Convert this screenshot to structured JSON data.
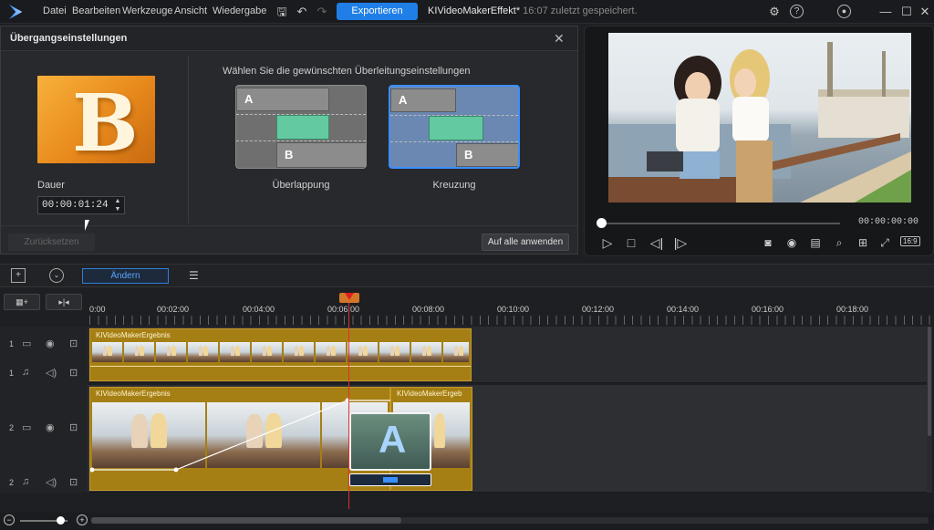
{
  "menu": {
    "file": "Datei",
    "edit": "Bearbeiten",
    "tools": "Werkzeuge",
    "view": "Ansicht",
    "playback": "Wiedergabe"
  },
  "toolbar": {
    "export_label": "Exportieren"
  },
  "project": {
    "name": "KIVideoMakerEffekt*",
    "saved": "16:07 zuletzt gespeichert."
  },
  "transition": {
    "title": "Übergangseinstellungen",
    "thumb_letter": "B",
    "duration_label": "Dauer",
    "duration_value": "00:00:01:24",
    "choose_label": "Wählen Sie die gewünschten Überleitungseinstellungen",
    "options": [
      {
        "label": "Überlappung",
        "selected": false
      },
      {
        "label": "Kreuzung",
        "selected": true
      }
    ],
    "block_a": "A",
    "block_b": "B",
    "reset_label": "Zurücksetzen",
    "apply_label": "Auf alle anwenden"
  },
  "preview": {
    "time": "00:00:00:00",
    "ratio": "16:9"
  },
  "timeline": {
    "modify_label": "Ändern",
    "ruler": [
      "0:00",
      "00:02:00",
      "00:04:00",
      "00:06:00",
      "00:08:00",
      "00:10:00",
      "00:12:00",
      "00:14:00",
      "00:16:00",
      "00:18:00"
    ],
    "tracks": [
      {
        "num": "1"
      },
      {
        "num": "1"
      },
      {
        "num": "2"
      },
      {
        "num": "2"
      }
    ],
    "clip_name": "KIVideoMakerErgebnis",
    "clip_name_short": "KIVideoMakerErgeb",
    "transition_letter": "A"
  },
  "colors": {
    "accent": "#1f7fe6",
    "clip": "#a57f14",
    "playhead": "#e03030"
  }
}
